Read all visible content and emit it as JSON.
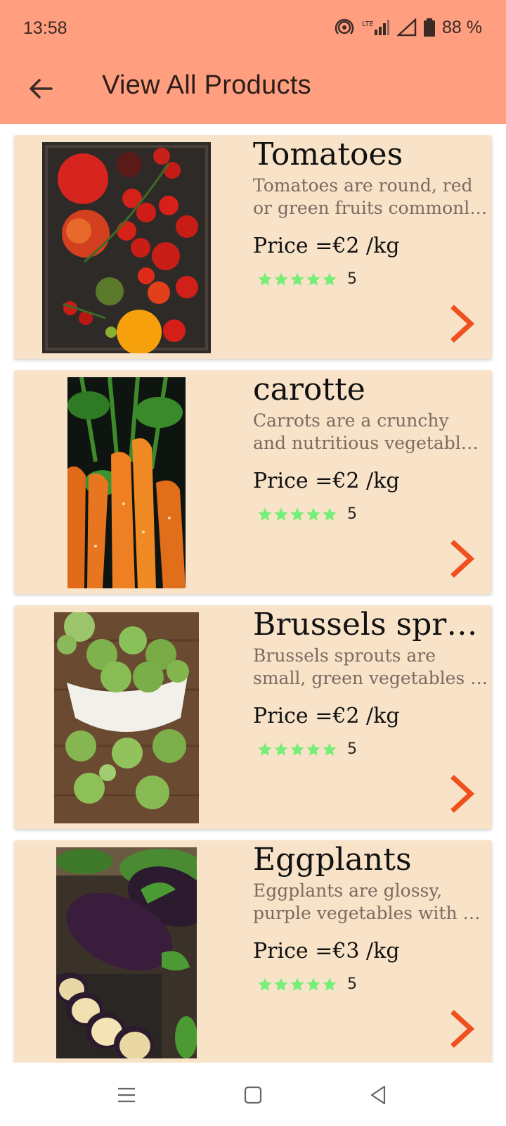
{
  "status": {
    "time": "13:58",
    "battery": "88 %"
  },
  "header": {
    "title": "View All Products"
  },
  "products": [
    {
      "name": "Tomatoes",
      "desc_line1": "Tomatoes are round, red",
      "desc_line2": "or green fruits commonly...",
      "price": "Price =€2 /kg",
      "rating": "5",
      "stars": 5
    },
    {
      "name": "carotte",
      "desc_line1": "Carrots are a crunchy",
      "desc_line2": "and nutritious vegetable, ...",
      "price": "Price =€2 /kg",
      "rating": "5",
      "stars": 5
    },
    {
      "name": "Brussels spro...",
      "desc_line1": "Brussels sprouts are",
      "desc_line2": "small, green vegetables th...",
      "price": "Price =€2 /kg",
      "rating": "5",
      "stars": 5
    },
    {
      "name": "Eggplants",
      "desc_line1": "Eggplants are glossy,",
      "desc_line2": "purple vegetables with a s...",
      "price": "Price =€3 /kg",
      "rating": "5",
      "stars": 5
    }
  ],
  "colors": {
    "header_bg": "#ff9f80",
    "card_bg": "#f8e3c8",
    "star": "#77ee77",
    "chevron": "#f0501e"
  }
}
